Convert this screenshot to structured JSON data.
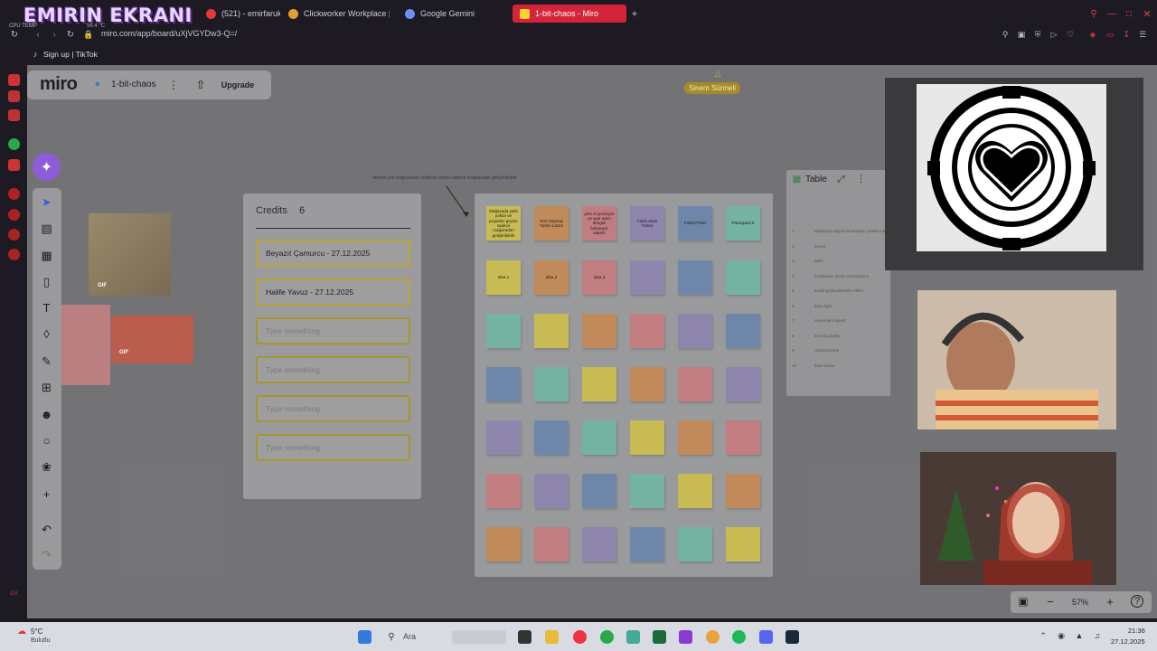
{
  "browser": {
    "overlay_brand": "EMIRIN EKRANI",
    "cpu_label": "CPU TEMP",
    "cpu_value": "56.4 °C",
    "tabs": [
      {
        "label": "(521) - emirfarukbr",
        "color": "#e53935"
      },
      {
        "label": "Clickworker Workplace |",
        "color": "#e0a030"
      },
      {
        "label": "Google Gemini",
        "color": "#6a8ff5"
      },
      {
        "label": "1-bit-chaos - Miro",
        "color": "#ffd02f"
      }
    ],
    "url": "miro.com/app/board/uXjVGYDw3-Q=/",
    "bookmark": "Sign up | TikTok"
  },
  "miro": {
    "logo": "miro",
    "board_name": "1-bit-chaos",
    "upgrade_label": "Upgrade",
    "collaborator": "Sinem Sürmeli",
    "zoom": "57%"
  },
  "gifs": [
    {
      "badge": "GIF"
    },
    {
      "badge": "GIF"
    }
  ],
  "credits": {
    "title": "Credits",
    "count": "6",
    "rows": [
      {
        "text": "Beyazıt Çamurcu - 27.12.2025",
        "empty": false
      },
      {
        "text": "Halife Yavuz - 27.12.2025",
        "empty": false
      },
      {
        "text": "Type something",
        "empty": true
      },
      {
        "text": "Type something",
        "empty": true
      },
      {
        "text": "Type something",
        "empty": true
      },
      {
        "text": "Type something",
        "empty": true
      }
    ]
  },
  "board_note": "nerelia yeti mağazadan anlatılan sonra sadece mağazadan geliştirilebilir",
  "stickies": {
    "header": [
      {
        "text": "Mağazada yetki yoktur ve projeden geçiler sadece mağazadan geliştirilebilir",
        "color": "yellow"
      },
      {
        "text": "Yeni Düşman Türleri Lazım",
        "color": "orange"
      },
      {
        "text": "yeni mi pozisyon ya ayar aracı dengeli bulunuyor sakarlı",
        "color": "pink"
      },
      {
        "text": "Farklı Silah Türleri",
        "color": "purple"
      },
      {
        "text": "Farklı Perler",
        "color": "blue"
      },
      {
        "text": "Participant 6",
        "color": "teal"
      }
    ],
    "rows": [
      [
        {
          "text": "Idea 1",
          "color": "yellow"
        },
        {
          "text": "Idea 2",
          "color": "orange"
        },
        {
          "text": "Idea 3",
          "color": "pink"
        },
        {
          "text": "",
          "color": "purple"
        },
        {
          "text": "",
          "color": "blue"
        },
        {
          "text": "",
          "color": "teal"
        }
      ],
      [
        {
          "text": "",
          "color": "teal"
        },
        {
          "text": "",
          "color": "yellow"
        },
        {
          "text": "",
          "color": "orange"
        },
        {
          "text": "",
          "color": "pink"
        },
        {
          "text": "",
          "color": "purple"
        },
        {
          "text": "",
          "color": "blue"
        }
      ],
      [
        {
          "text": "",
          "color": "blue"
        },
        {
          "text": "",
          "color": "teal"
        },
        {
          "text": "",
          "color": "yellow"
        },
        {
          "text": "",
          "color": "orange"
        },
        {
          "text": "",
          "color": "pink"
        },
        {
          "text": "",
          "color": "purple"
        }
      ],
      [
        {
          "text": "",
          "color": "purple"
        },
        {
          "text": "",
          "color": "blue"
        },
        {
          "text": "",
          "color": "teal"
        },
        {
          "text": "",
          "color": "yellow"
        },
        {
          "text": "",
          "color": "orange"
        },
        {
          "text": "",
          "color": "pink"
        }
      ],
      [
        {
          "text": "",
          "color": "pink"
        },
        {
          "text": "",
          "color": "purple"
        },
        {
          "text": "",
          "color": "blue"
        },
        {
          "text": "",
          "color": "teal"
        },
        {
          "text": "",
          "color": "yellow"
        },
        {
          "text": "",
          "color": "orange"
        }
      ],
      [
        {
          "text": "",
          "color": "orange"
        },
        {
          "text": "",
          "color": "pink"
        },
        {
          "text": "",
          "color": "purple"
        },
        {
          "text": "",
          "color": "blue"
        },
        {
          "text": "",
          "color": "teal"
        },
        {
          "text": "",
          "color": "yellow"
        }
      ]
    ]
  },
  "table": {
    "title": "Table",
    "rows": [
      {
        "n": "1",
        "text": "Mağazaya ilgiyle kazandığın yetkiler hacı yaparak değil ağaçlı"
      },
      {
        "n": "2",
        "text": "kumar"
      },
      {
        "n": "3",
        "text": "dash"
      },
      {
        "n": "4",
        "text": "kombiasyu dizum animasyonu"
      },
      {
        "n": "5",
        "text": "arada güçlendirmeler eklen"
      },
      {
        "n": "6",
        "text": "boss fight"
      },
      {
        "n": "7",
        "text": "movement speed"
      },
      {
        "n": "8",
        "text": "tracking bullet"
      },
      {
        "n": "9",
        "text": "randomizeme"
      },
      {
        "n": "10",
        "text": "basit tutma"
      }
    ]
  },
  "taskbar": {
    "weather_temp": "5°C",
    "weather_desc": "Bulutlu",
    "search_placeholder": "Ara",
    "time": "21:36",
    "date": "27.12.2025"
  }
}
